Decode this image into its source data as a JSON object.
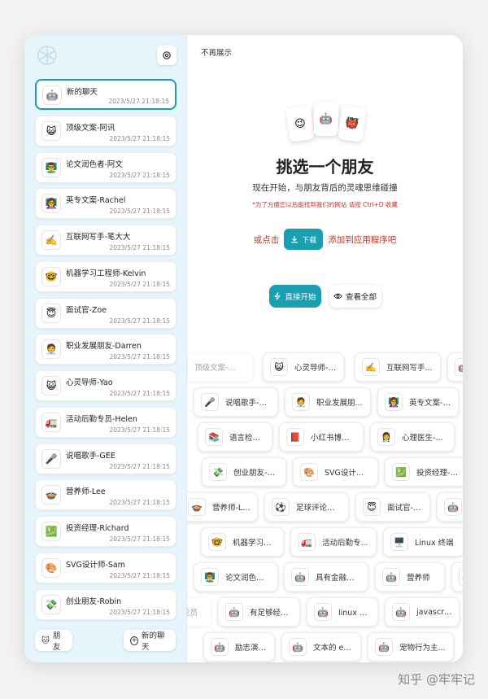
{
  "sidebar": {
    "chats": [
      {
        "title": "新的聊天",
        "time": "2023/5/27 21:18:15",
        "emoji": "🤖"
      },
      {
        "title": "顶级文案-阿讯",
        "time": "2023/5/27 21:18:15",
        "emoji": "😺"
      },
      {
        "title": "论文润色者-阿文",
        "time": "2023/5/27 21:18:15",
        "emoji": "👨‍🏫"
      },
      {
        "title": "英专文案-Rachel",
        "time": "2023/5/27 21:18:15",
        "emoji": "👩‍🏫"
      },
      {
        "title": "互联网写手-笔大大",
        "time": "2023/5/27 21:18:15",
        "emoji": "✍️"
      },
      {
        "title": "机器学习工程师-Kelvin",
        "time": "2023/5/27 21:18:15",
        "emoji": "🤓"
      },
      {
        "title": "面试官-Zoe",
        "time": "2023/5/27 21:18:15",
        "emoji": "😇"
      },
      {
        "title": "职业发展朋友-Darren",
        "time": "2023/5/27 21:18:15",
        "emoji": "🧑‍💼"
      },
      {
        "title": "心灵导师-Yao",
        "time": "2023/5/27 21:18:15",
        "emoji": "😺"
      },
      {
        "title": "活动后勤专员-Helen",
        "time": "2023/5/27 21:18:15",
        "emoji": "🚛"
      },
      {
        "title": "说唱歌手-GEE",
        "time": "2023/5/27 21:18:15",
        "emoji": "🎤"
      },
      {
        "title": "营养师-Lee",
        "time": "2023/5/27 21:18:15",
        "emoji": "🍲"
      },
      {
        "title": "投资经理-Richard",
        "time": "2023/5/27 21:18:15",
        "emoji": "💹"
      },
      {
        "title": "SVG设计师-Sam",
        "time": "2023/5/27 21:18:15",
        "emoji": "🎨"
      },
      {
        "title": "创业朋友-Robin",
        "time": "2023/5/27 21:18:15",
        "emoji": "💸"
      }
    ],
    "footer": {
      "mask_label": "朋友",
      "new_chat_label": "新的聊天"
    }
  },
  "main": {
    "no_show": "不再展示",
    "cards": [
      "😉",
      "🤖",
      "👹"
    ],
    "title": "挑选一个朋友",
    "subtitle": "现在开始，与朋友背后的灵魂思维碰撞",
    "tip": "*为了方便您以后能找到我们的网站 请按 Ctrl+D 收藏",
    "or_click": "或点击",
    "download": "下载",
    "add_app": "添加到应用程序吧",
    "start": "直接开始",
    "view_all": "查看全部"
  },
  "mask_rows": [
    [
      {
        "label": "顶级文案-...",
        "emoji": "😺",
        "faded": true
      },
      {
        "label": "心灵导师-Yao",
        "emoji": "😺"
      },
      {
        "label": "互联网写手...",
        "emoji": "✍️"
      },
      {
        "label": "",
        "emoji": "🤖"
      }
    ],
    [
      {
        "label": "说唱歌手-G...",
        "emoji": "🎤"
      },
      {
        "label": "职业发展朋...",
        "emoji": "🧑‍💼"
      },
      {
        "label": "英专文案-R...",
        "emoji": "👩‍🏫"
      }
    ],
    [
      {
        "label": "语言检测器",
        "emoji": "📚"
      },
      {
        "label": "小红书博主...",
        "emoji": "📕"
      },
      {
        "label": "心理医生-...",
        "emoji": "👩‍⚕️"
      }
    ],
    [
      {
        "label": "创业朋友-R...",
        "emoji": "💸"
      },
      {
        "label": "SVG设计师...",
        "emoji": "🎨"
      },
      {
        "label": "投资经理-R...",
        "emoji": "💹"
      }
    ],
    [
      {
        "label": "营养师-Lee",
        "emoji": "🍲"
      },
      {
        "label": "足球评论员...",
        "emoji": "⚽"
      },
      {
        "label": "面试官-Zoe",
        "emoji": "😇"
      },
      {
        "label": "",
        "emoji": "🤖"
      }
    ],
    [
      {
        "label": "机器学习工程...",
        "emoji": "🤓"
      },
      {
        "label": "活动后勤专...",
        "emoji": "🚛"
      },
      {
        "label": "Linux 终端",
        "emoji": "🖥️"
      }
    ],
    [
      {
        "label": "论文润色者...",
        "emoji": "👨‍🏫"
      },
      {
        "label": "具有金融市...",
        "emoji": "🤖"
      },
      {
        "label": "营养师",
        "emoji": "🤖"
      },
      {
        "label": "",
        "emoji": "🤖"
      }
    ],
    [
      {
        "label": "论员",
        "emoji": "",
        "faded": true
      },
      {
        "label": "有足够经验...",
        "emoji": "🤖"
      },
      {
        "label": "linux 终端",
        "emoji": "🤖"
      },
      {
        "label": "javascript ...",
        "emoji": "🤖"
      }
    ],
    [
      {
        "label": "励志演说家",
        "emoji": "🤖"
      },
      {
        "label": "文本的 excel",
        "emoji": "🤖"
      },
      {
        "label": "宠物行为主...",
        "emoji": "🤖"
      }
    ]
  ],
  "watermark": "知乎 @牢牢记"
}
